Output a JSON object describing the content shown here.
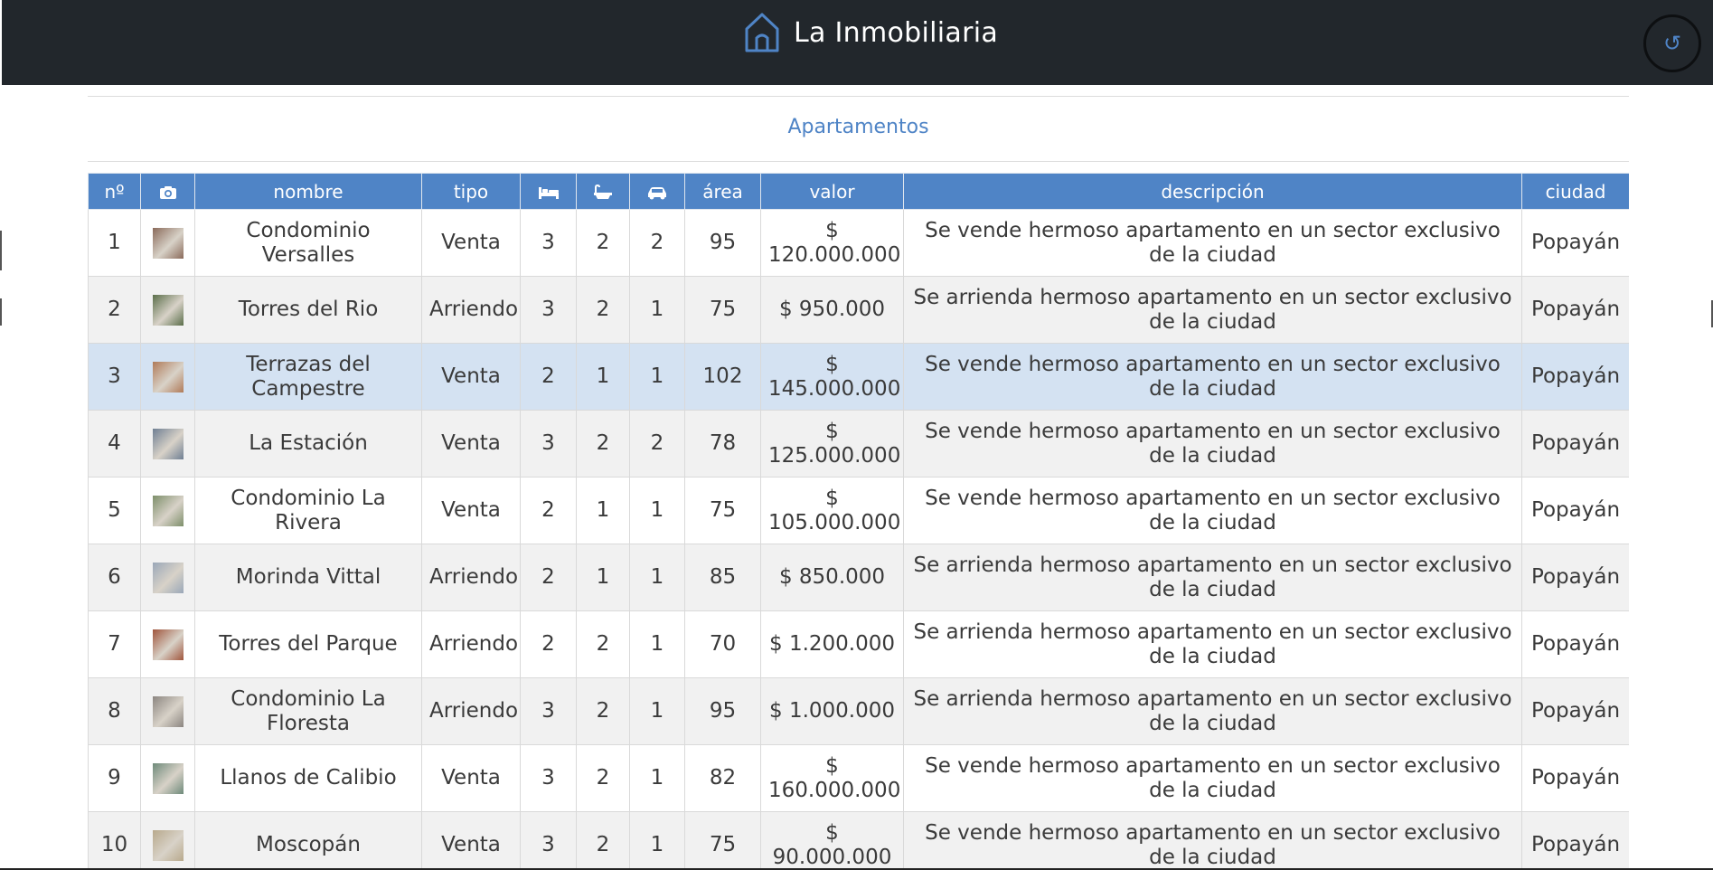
{
  "header": {
    "title": "La Inmobiliaria",
    "refresh_icon": "refresh-icon",
    "home_icon": "house-icon"
  },
  "section": {
    "title": "Apartamentos"
  },
  "table": {
    "columns": {
      "n": "nº",
      "foto": "camera-icon",
      "nombre": "nombre",
      "tipo": "tipo",
      "habitaciones": "bed-icon",
      "banos": "bathtub-icon",
      "parqueaderos": "car-icon",
      "area": "área",
      "valor": "valor",
      "descripcion": "descripción",
      "ciudad": "ciudad"
    },
    "rows": [
      {
        "n": "1",
        "nombre": "Condominio Versalles",
        "tipo": "Venta",
        "hab": "3",
        "ban": "2",
        "par": "2",
        "area": "95",
        "valor": "$ 120.000.000",
        "descripcion": "Se vende hermoso apartamento en un sector exclusivo de la ciudad",
        "ciudad": "Popayán",
        "thumb": "#8a6a5a"
      },
      {
        "n": "2",
        "nombre": "Torres del Rio",
        "tipo": "Arriendo",
        "hab": "3",
        "ban": "2",
        "par": "1",
        "area": "75",
        "valor": "$ 950.000",
        "descripcion": "Se arrienda hermoso apartamento en un sector exclusivo de la ciudad",
        "ciudad": "Popayán",
        "thumb": "#5b6e4a"
      },
      {
        "n": "3",
        "nombre": "Terrazas del Campestre",
        "tipo": "Venta",
        "hab": "2",
        "ban": "1",
        "par": "1",
        "area": "102",
        "valor": "$ 145.000.000",
        "descripcion": "Se vende hermoso apartamento en un sector exclusivo de la ciudad",
        "ciudad": "Popayán",
        "thumb": "#b07a58"
      },
      {
        "n": "4",
        "nombre": "La Estación",
        "tipo": "Venta",
        "hab": "3",
        "ban": "2",
        "par": "2",
        "area": "78",
        "valor": "$ 125.000.000",
        "descripcion": "Se vende hermoso apartamento en un sector exclusivo de la ciudad",
        "ciudad": "Popayán",
        "thumb": "#6f7f93"
      },
      {
        "n": "5",
        "nombre": "Condominio La Rivera",
        "tipo": "Venta",
        "hab": "2",
        "ban": "1",
        "par": "1",
        "area": "75",
        "valor": "$ 105.000.000",
        "descripcion": "Se vende hermoso apartamento en un sector exclusivo de la ciudad",
        "ciudad": "Popayán",
        "thumb": "#7d8f6a"
      },
      {
        "n": "6",
        "nombre": "Morinda Vittal",
        "tipo": "Arriendo",
        "hab": "2",
        "ban": "1",
        "par": "1",
        "area": "85",
        "valor": "$ 850.000",
        "descripcion": "Se arrienda hermoso apartamento en un sector exclusivo de la ciudad",
        "ciudad": "Popayán",
        "thumb": "#9aa7b8"
      },
      {
        "n": "7",
        "nombre": "Torres del Parque",
        "tipo": "Arriendo",
        "hab": "2",
        "ban": "2",
        "par": "1",
        "area": "70",
        "valor": "$ 1.200.000",
        "descripcion": "Se arrienda hermoso apartamento en un sector exclusivo de la ciudad",
        "ciudad": "Popayán",
        "thumb": "#a0553c"
      },
      {
        "n": "8",
        "nombre": "Condominio La Floresta",
        "tipo": "Arriendo",
        "hab": "3",
        "ban": "2",
        "par": "1",
        "area": "95",
        "valor": "$ 1.000.000",
        "descripcion": "Se arrienda hermoso apartamento en un sector exclusivo de la ciudad",
        "ciudad": "Popayán",
        "thumb": "#8b8580"
      },
      {
        "n": "9",
        "nombre": "Llanos de Calibio",
        "tipo": "Venta",
        "hab": "3",
        "ban": "2",
        "par": "1",
        "area": "82",
        "valor": "$ 160.000.000",
        "descripcion": "Se vende hermoso apartamento en un sector exclusivo de la ciudad",
        "ciudad": "Popayán",
        "thumb": "#6e8a7a"
      },
      {
        "n": "10",
        "nombre": "Moscopán",
        "tipo": "Venta",
        "hab": "3",
        "ban": "2",
        "par": "1",
        "area": "75",
        "valor": "$ 90.000.000",
        "descripcion": "Se vende hermoso apartamento en un sector exclusivo de la ciudad",
        "ciudad": "Popayán",
        "thumb": "#b8a98c"
      }
    ],
    "selected_row": 3
  },
  "colors": {
    "header_bg": "#22272c",
    "accent": "#4f84c6",
    "row_alt": "#f1f1f1",
    "row_selected": "#d4e2f2"
  }
}
